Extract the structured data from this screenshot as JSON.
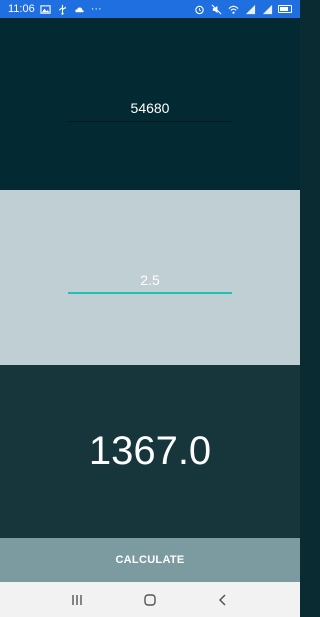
{
  "status_bar": {
    "time": "11:06",
    "left_icons": [
      "gallery-icon",
      "usb-icon",
      "cloud-icon",
      "more-dots-icon"
    ],
    "right_icons": [
      "alarm-icon",
      "mute-icon",
      "wifi-icon",
      "signal-icon",
      "signal-icon",
      "battery-icon"
    ],
    "more_dots": "···"
  },
  "inputs": {
    "amount_value": "54680",
    "rate_value": "2.5"
  },
  "result": {
    "value": "1367.0"
  },
  "actions": {
    "calculate_label": "CALCULATE"
  },
  "colors": {
    "status_bar": "#1f6fe0",
    "panel_top": "#032a33",
    "panel_mid": "#bfcfd3",
    "panel_result": "#17363b",
    "button": "#7b9ba1",
    "accent": "#1ec1b3"
  },
  "nav_bar": {
    "buttons": [
      "recent-apps-icon",
      "home-icon",
      "back-icon"
    ]
  }
}
